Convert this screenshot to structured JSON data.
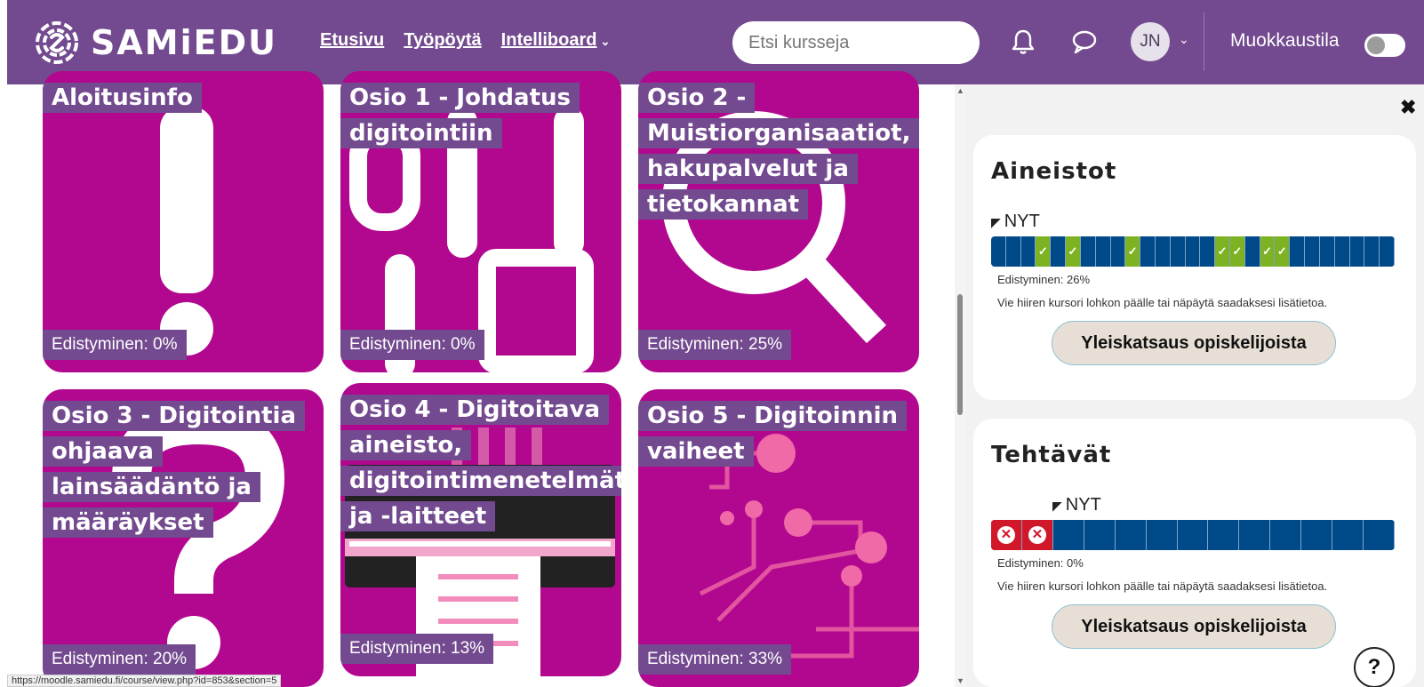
{
  "brand": {
    "name": "SAMiEDU"
  },
  "nav": {
    "links": [
      {
        "label": "Etusivu"
      },
      {
        "label": "Työpöytä"
      },
      {
        "label": "Intelliboard"
      }
    ],
    "search_placeholder": "Etsi kursseja",
    "avatar_initials": "JN",
    "edit_mode_label": "Muokkaustila",
    "edit_mode_on": false
  },
  "sections": [
    {
      "title": "Aloitusinfo",
      "progress": "Edistyminen: 0%",
      "percent": 0,
      "icon": "exclamation-icon"
    },
    {
      "title": "Osio 1 - Johdatus digitointiin",
      "progress": "Edistyminen: 0%",
      "percent": 0,
      "icon": "binary-icon"
    },
    {
      "title": "Osio 2 - Muistiorganisaatiot, hakupalvelut ja tietokannat",
      "progress": "Edistyminen: 25%",
      "percent": 25,
      "icon": "magnifier-icon"
    },
    {
      "title": "Osio 3 - Digitointia ohjaava lainsäädäntö ja määräykset",
      "progress": "Edistyminen: 20%",
      "percent": 20,
      "icon": "question-mark-icon"
    },
    {
      "title": "Osio 4 - Digitoitava aineisto, digitointimenetelmät ja -laitteet",
      "progress": "Edistyminen: 13%",
      "percent": 13,
      "icon": "scanner-icon"
    },
    {
      "title": "Osio 5 - Digitoinnin vaiheet",
      "progress": "Edistyminen: 33%",
      "percent": 33,
      "icon": "circuit-icon"
    }
  ],
  "blocks": [
    {
      "title": "Aineistot",
      "now_label": "NYT",
      "cells": 27,
      "done_cells": [
        3,
        5,
        9,
        15,
        16,
        18,
        19
      ],
      "failed_cells": [],
      "progress_text": "Edistyminen: 26%",
      "hint": "Vie hiiren kursori lohkon päälle tai näpäytä saadaksesi lisätietoa.",
      "button_label": "Yleiskatsaus opiskelijoista"
    },
    {
      "title": "Tehtävät",
      "now_label": "NYT",
      "cells": 13,
      "done_cells": [],
      "failed_cells": [
        0,
        1
      ],
      "progress_text": "Edistyminen: 0%",
      "hint": "Vie hiiren kursori lohkon päälle tai näpäytä saadaksesi lisätietoa.",
      "button_label": "Yleiskatsaus opiskelijoista"
    }
  ],
  "help_label": "?",
  "status_url": "https://moodle.samiedu.fi/course/view.php?id=853&section=5",
  "colors": {
    "navbar": "#734a8f",
    "card": "#b1088f",
    "progress_bar": "#004a89",
    "done": "#7db223",
    "failed": "#d1172a"
  }
}
